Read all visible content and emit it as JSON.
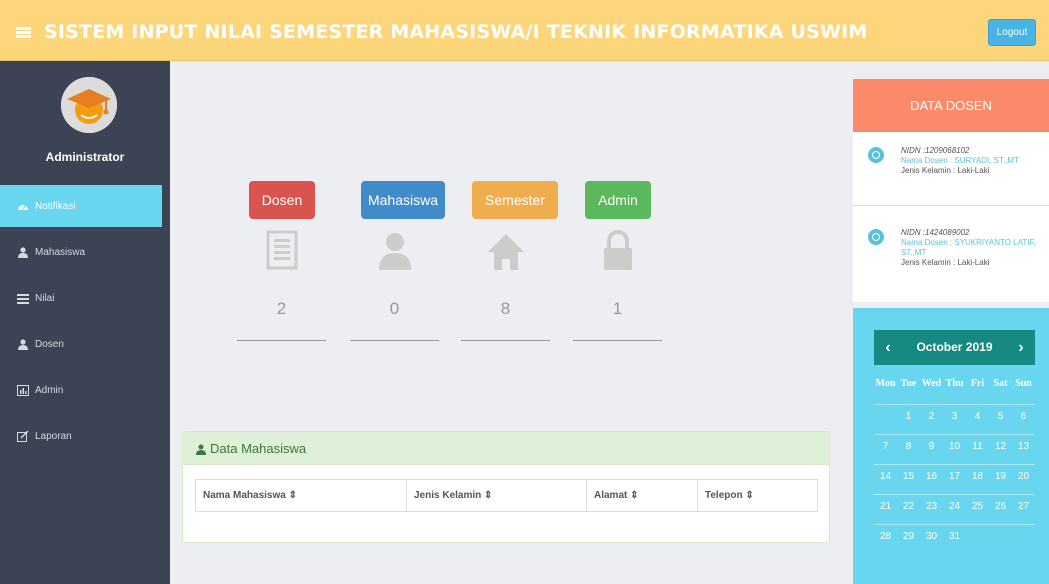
{
  "header": {
    "title": "SISTEM INPUT NILAI SEMESTER MAHASISWA/I TEKNIK INFORMATIKA USWIM",
    "logout_label": "Logout",
    "bg_color": "#fdd67c"
  },
  "sidebar": {
    "admin_name": "Administrator",
    "items": [
      {
        "label": "Notifikasi",
        "icon": "dashboard-icon",
        "active": true
      },
      {
        "label": "Mahasiswa",
        "icon": "user-icon",
        "active": false
      },
      {
        "label": "Nilai",
        "icon": "list-icon",
        "active": false
      },
      {
        "label": "Dosen",
        "icon": "user-icon",
        "active": false
      },
      {
        "label": "Admin",
        "icon": "chart-icon",
        "active": false
      },
      {
        "label": "Laporan",
        "icon": "edit-icon",
        "active": false
      }
    ]
  },
  "stats": [
    {
      "label": "Dosen",
      "value": "2",
      "color": "#d9534f",
      "icon": "list-alt-icon"
    },
    {
      "label": "Mahasiswa",
      "value": "0",
      "color": "#428bca",
      "icon": "user-icon"
    },
    {
      "label": "Semester",
      "value": "8",
      "color": "#f0ad4e",
      "icon": "home-icon"
    },
    {
      "label": "Admin",
      "value": "1",
      "color": "#5cb85c",
      "icon": "lock-icon"
    }
  ],
  "mahasiswa_panel": {
    "title": "Data Mahasiswa",
    "columns": [
      "Nama Mahasiswa",
      "Jenis Kelamin",
      "Alamat",
      "Telepon"
    ]
  },
  "dosen": {
    "title": "DATA DOSEN",
    "items": [
      {
        "nidn": "NIDN :1209068102",
        "nama": "Nama Dosen : SURYADI, ST.,MT",
        "jk": "Jenis Kelamin : Laki-Laki"
      },
      {
        "nidn": "NIDN :1424089002",
        "nama": "Nama Dosen : SYUKRIYANTO LATIF, ST.,MT",
        "jk": "Jenis Kelamin : Laki-Laki"
      }
    ]
  },
  "calendar": {
    "month": "October 2019",
    "prev": "‹",
    "next": "›",
    "days_of_week": [
      "Mon",
      "Tue",
      "Wed",
      "Thu",
      "Fri",
      "Sat",
      "Sun"
    ],
    "weeks": [
      [
        "",
        "1",
        "2",
        "3",
        "4",
        "5",
        "6"
      ],
      [
        "7",
        "8",
        "9",
        "10",
        "11",
        "12",
        "13"
      ],
      [
        "14",
        "15",
        "16",
        "17",
        "18",
        "19",
        "20"
      ],
      [
        "21",
        "22",
        "23",
        "24",
        "25",
        "26",
        "27"
      ],
      [
        "28",
        "29",
        "30",
        "31",
        "",
        "",
        ""
      ]
    ]
  }
}
